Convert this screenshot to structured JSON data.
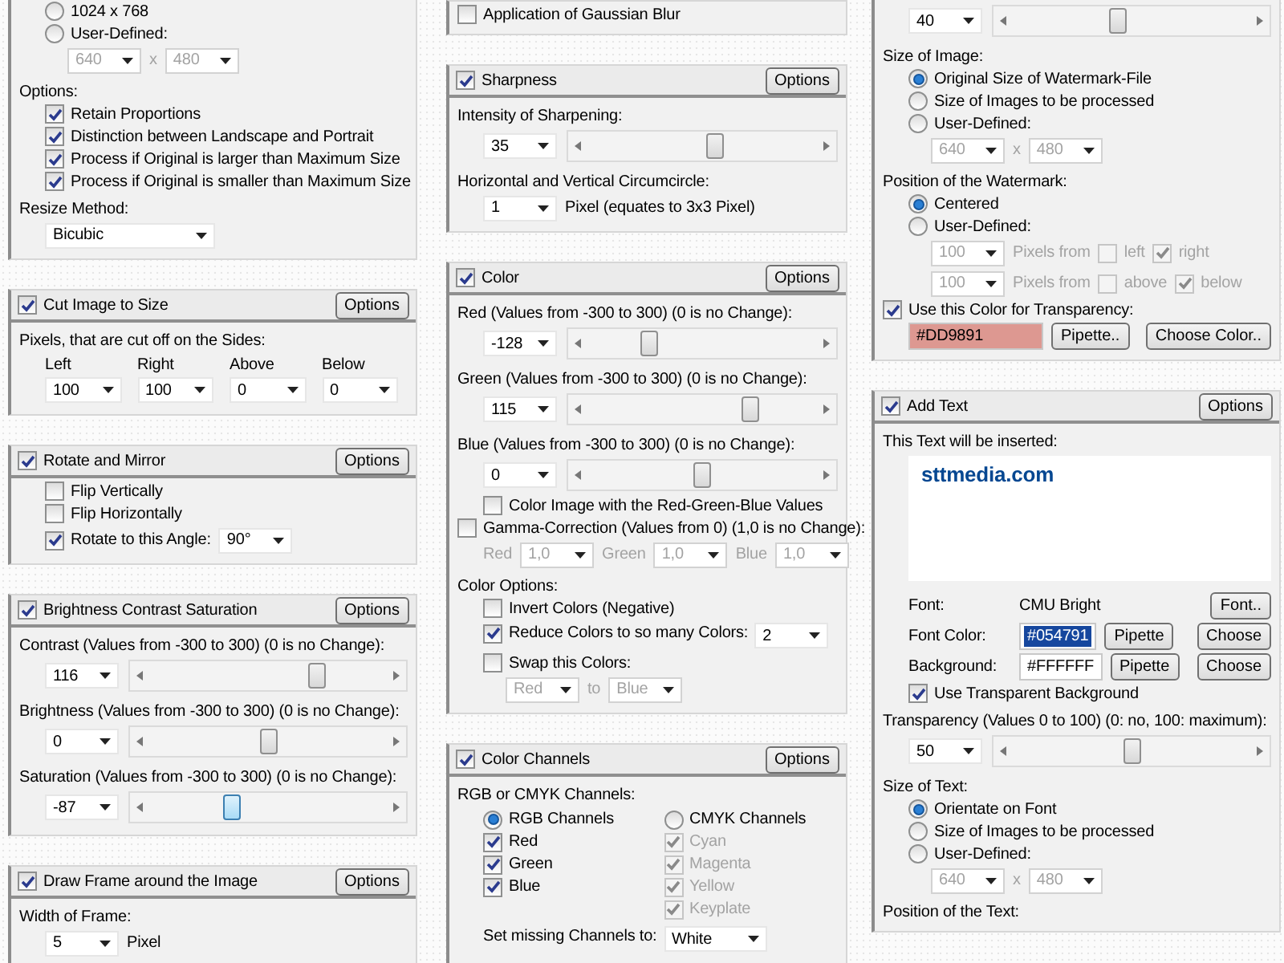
{
  "columns": [
    {
      "panels": [
        {
          "rows": [
            {
              "kind": "line",
              "items": [
                {
                  "kind": "radio",
                  "label": "1024 x 768",
                  "selected": false
                }
              ]
            },
            {
              "kind": "line",
              "items": [
                {
                  "kind": "radio",
                  "label": "User-Defined:",
                  "selected": false
                }
              ]
            },
            {
              "kind": "subline",
              "items": [
                {
                  "kind": "combo",
                  "value": "640",
                  "disabled": true
                },
                {
                  "kind": "text",
                  "text": "x",
                  "disabled": true
                },
                {
                  "kind": "combo",
                  "value": "480",
                  "disabled": true
                }
              ]
            },
            {
              "kind": "label",
              "text": "Options:"
            },
            {
              "kind": "line",
              "items": [
                {
                  "kind": "check",
                  "label": "Retain Proportions",
                  "checked": true,
                  "disabled": false
                }
              ]
            },
            {
              "kind": "line",
              "items": [
                {
                  "kind": "check",
                  "label": "Distinction between Landscape and Portrait",
                  "checked": true,
                  "disabled": false
                }
              ]
            },
            {
              "kind": "line",
              "items": [
                {
                  "kind": "check",
                  "label": "Process if Original is larger than Maximum Size",
                  "checked": true,
                  "disabled": false
                }
              ]
            },
            {
              "kind": "line",
              "items": [
                {
                  "kind": "check",
                  "label": "Process if Original is smaller than Maximum Size",
                  "checked": true,
                  "disabled": false
                }
              ]
            },
            {
              "kind": "label",
              "text": "Resize Method:"
            },
            {
              "kind": "line",
              "items": [
                {
                  "kind": "dropdown",
                  "value": "Bicubic",
                  "disabled": false
                }
              ]
            }
          ]
        },
        {
          "title": "Cut Image to Size",
          "checked": true,
          "button": "Options",
          "rows": [
            {
              "kind": "label",
              "text": "Pixels, that are cut off on the Sides:"
            },
            {
              "kind": "columns",
              "columns": [
                [
                  {
                    "kind": "text",
                    "text": "Left",
                    "disabled": false
                  },
                  {
                    "kind": "combo",
                    "value": "100",
                    "disabled": false
                  }
                ],
                [
                  {
                    "kind": "text",
                    "text": "Right",
                    "disabled": false
                  },
                  {
                    "kind": "combo",
                    "value": "100",
                    "disabled": false
                  }
                ],
                [
                  {
                    "kind": "text",
                    "text": "Above",
                    "disabled": false
                  },
                  {
                    "kind": "combo",
                    "value": "0",
                    "disabled": false
                  }
                ],
                [
                  {
                    "kind": "text",
                    "text": "Below",
                    "disabled": false
                  },
                  {
                    "kind": "combo",
                    "value": "0",
                    "disabled": false
                  }
                ]
              ]
            }
          ]
        },
        {
          "title": "Rotate and Mirror",
          "checked": true,
          "button": "Options",
          "rows": [
            {
              "kind": "line",
              "items": [
                {
                  "kind": "check",
                  "label": "Flip Vertically",
                  "checked": false,
                  "disabled": false
                }
              ]
            },
            {
              "kind": "line",
              "items": [
                {
                  "kind": "check",
                  "label": "Flip Horizontally",
                  "checked": false,
                  "disabled": false
                }
              ]
            },
            {
              "kind": "line",
              "items": [
                {
                  "kind": "check",
                  "label": "Rotate to this Angle:",
                  "checked": true,
                  "disabled": false
                },
                {
                  "kind": "combo",
                  "value": "90°",
                  "disabled": false
                }
              ]
            }
          ]
        },
        {
          "title": "Brightness Contrast Saturation",
          "checked": true,
          "button": "Options",
          "rows": [
            {
              "kind": "label",
              "text": "Contrast (Values from -300 to 300) (0 is no Change):"
            },
            {
              "kind": "slider",
              "value": "116",
              "level": 0.69,
              "focused": false
            },
            {
              "kind": "label",
              "text": "Brightness (Values from -300 to 300) (0 is no Change):"
            },
            {
              "kind": "slider",
              "value": "0",
              "level": 0.5,
              "focused": false
            },
            {
              "kind": "label",
              "text": "Saturation (Values from -300 to 300) (0 is no Change):"
            },
            {
              "kind": "slider",
              "value": "-87",
              "level": 0.36,
              "focused": true
            }
          ]
        },
        {
          "title": "Draw Frame around the Image",
          "checked": true,
          "button": "Options",
          "rows": [
            {
              "kind": "label",
              "text": "Width of Frame:"
            },
            {
              "kind": "line",
              "items": [
                {
                  "kind": "combo",
                  "value": "5",
                  "disabled": false
                },
                {
                  "kind": "text",
                  "text": "Pixel",
                  "disabled": false
                }
              ]
            }
          ]
        }
      ]
    },
    {
      "panels": [
        {
          "rows": [
            {
              "kind": "flush",
              "items": [
                {
                  "kind": "check",
                  "label": "Application of Gaussian Blur",
                  "checked": false,
                  "disabled": false
                }
              ]
            }
          ]
        },
        {
          "title": "Sharpness",
          "checked": true,
          "button": "Options",
          "rows": [
            {
              "kind": "label",
              "text": "Intensity of Sharpening:"
            },
            {
              "kind": "slider",
              "value": "35",
              "level": 0.55,
              "focused": false
            },
            {
              "kind": "label",
              "text": "Horizontal and Vertical Circumcircle:"
            },
            {
              "kind": "line",
              "items": [
                {
                  "kind": "combo",
                  "value": "1",
                  "disabled": false
                },
                {
                  "kind": "text",
                  "text": "Pixel (equates to 3x3 Pixel)",
                  "disabled": false
                }
              ]
            }
          ]
        },
        {
          "title": "Color",
          "checked": true,
          "button": "Options",
          "rows": [
            {
              "kind": "label",
              "text": "Red (Values from -300 to 300) (0 is no Change):"
            },
            {
              "kind": "slider",
              "value": "-128",
              "level": 0.29,
              "focused": false
            },
            {
              "kind": "label",
              "text": "Green (Values from -300 to 300) (0 is no Change):"
            },
            {
              "kind": "slider",
              "value": "115",
              "level": 0.69,
              "focused": false
            },
            {
              "kind": "label",
              "text": "Blue (Values from -300 to 300) (0 is no Change):"
            },
            {
              "kind": "slider",
              "value": "0",
              "level": 0.5,
              "focused": false
            },
            {
              "kind": "line",
              "items": [
                {
                  "kind": "check",
                  "label": "Color Image with the Red-Green-Blue Values",
                  "checked": false,
                  "disabled": false
                }
              ]
            },
            {
              "kind": "flush",
              "items": [
                {
                  "kind": "check",
                  "label": "Gamma-Correction (Values from 0) (1,0 is no Change):",
                  "checked": false,
                  "disabled": false
                }
              ]
            },
            {
              "kind": "line",
              "items": [
                {
                  "kind": "text",
                  "text": "Red",
                  "disabled": true
                },
                {
                  "kind": "combo",
                  "value": "1,0",
                  "disabled": true
                },
                {
                  "kind": "text",
                  "text": "Green",
                  "disabled": true
                },
                {
                  "kind": "combo",
                  "value": "1,0",
                  "disabled": true
                },
                {
                  "kind": "text",
                  "text": "Blue",
                  "disabled": true
                },
                {
                  "kind": "combo",
                  "value": "1,0",
                  "disabled": true
                }
              ]
            },
            {
              "kind": "label",
              "text": "Color Options:"
            },
            {
              "kind": "line",
              "items": [
                {
                  "kind": "check",
                  "label": "Invert Colors (Negative)",
                  "checked": false,
                  "disabled": false
                }
              ]
            },
            {
              "kind": "columns",
              "columns": [
                [
                  {
                    "kind": "check",
                    "label": "Reduce Colors to so many Colors:",
                    "checked": true,
                    "disabled": false
                  }
                ],
                [
                  {
                    "kind": "combo",
                    "value": "2",
                    "disabled": false
                  }
                ]
              ]
            },
            {
              "kind": "line",
              "items": [
                {
                  "kind": "check",
                  "label": "Swap this Colors:",
                  "checked": false,
                  "disabled": false
                }
              ]
            },
            {
              "kind": "subline",
              "items": [
                {
                  "kind": "combo",
                  "value": "Red",
                  "disabled": true
                },
                {
                  "kind": "text",
                  "text": "to",
                  "disabled": true
                },
                {
                  "kind": "combo",
                  "value": "Blue",
                  "disabled": true
                }
              ]
            }
          ]
        },
        {
          "title": "Color Channels",
          "checked": true,
          "button": "Options",
          "rows": [
            {
              "kind": "label",
              "text": "RGB or CMYK Channels:"
            },
            {
              "kind": "columns",
              "columns": [
                [
                  {
                    "kind": "radio",
                    "label": "RGB Channels",
                    "selected": true
                  },
                  {
                    "kind": "check",
                    "label": "Red",
                    "checked": true,
                    "disabled": false
                  },
                  {
                    "kind": "check",
                    "label": "Green",
                    "checked": true,
                    "disabled": false
                  },
                  {
                    "kind": "check",
                    "label": "Blue",
                    "checked": true,
                    "disabled": false
                  }
                ],
                [
                  {
                    "kind": "radio",
                    "label": "CMYK Channels",
                    "selected": false
                  },
                  {
                    "kind": "check",
                    "label": "Cyan",
                    "checked": true,
                    "disabled": true
                  },
                  {
                    "kind": "check",
                    "label": "Magenta",
                    "checked": true,
                    "disabled": true
                  },
                  {
                    "kind": "check",
                    "label": "Yellow",
                    "checked": true,
                    "disabled": true
                  },
                  {
                    "kind": "check",
                    "label": "Keyplate",
                    "checked": true,
                    "disabled": true
                  }
                ]
              ]
            },
            {
              "kind": "columns",
              "columns": [
                [
                  {
                    "kind": "text",
                    "text": "Set missing Channels to:",
                    "disabled": false
                  }
                ],
                [
                  {
                    "kind": "combo",
                    "value": "White",
                    "disabled": false
                  }
                ]
              ]
            }
          ]
        }
      ]
    },
    {
      "panels": [
        {
          "rows": [
            {
              "kind": "slider",
              "value": "40",
              "level": 0.45,
              "focused": false
            },
            {
              "kind": "label",
              "text": "Size of Image:"
            },
            {
              "kind": "line",
              "items": [
                {
                  "kind": "radio",
                  "label": "Original Size of Watermark-File",
                  "selected": true
                }
              ]
            },
            {
              "kind": "line",
              "items": [
                {
                  "kind": "radio",
                  "label": "Size of Images to be processed",
                  "selected": false
                }
              ]
            },
            {
              "kind": "line",
              "items": [
                {
                  "kind": "radio",
                  "label": "User-Defined:",
                  "selected": false
                }
              ]
            },
            {
              "kind": "subline",
              "items": [
                {
                  "kind": "combo",
                  "value": "640",
                  "disabled": true
                },
                {
                  "kind": "text",
                  "text": "x",
                  "disabled": true
                },
                {
                  "kind": "combo",
                  "value": "480",
                  "disabled": true
                }
              ]
            },
            {
              "kind": "label",
              "text": "Position of the Watermark:"
            },
            {
              "kind": "line",
              "items": [
                {
                  "kind": "radio",
                  "label": "Centered",
                  "selected": true
                }
              ]
            },
            {
              "kind": "line",
              "items": [
                {
                  "kind": "radio",
                  "label": "User-Defined:",
                  "selected": false
                }
              ]
            },
            {
              "kind": "subline",
              "items": [
                {
                  "kind": "combo",
                  "value": "100",
                  "disabled": true
                },
                {
                  "kind": "text",
                  "text": "Pixels from",
                  "disabled": true
                },
                {
                  "kind": "check",
                  "label": "left",
                  "checked": false,
                  "disabled": true
                },
                {
                  "kind": "check",
                  "label": "right",
                  "checked": true,
                  "disabled": true
                }
              ]
            },
            {
              "kind": "subline",
              "items": [
                {
                  "kind": "combo",
                  "value": "100",
                  "disabled": true
                },
                {
                  "kind": "text",
                  "text": "Pixels from",
                  "disabled": true
                },
                {
                  "kind": "check",
                  "label": "above",
                  "checked": false,
                  "disabled": true
                },
                {
                  "kind": "check",
                  "label": "below",
                  "checked": true,
                  "disabled": true
                }
              ]
            },
            {
              "kind": "flush",
              "items": [
                {
                  "kind": "check",
                  "label": "Use this Color for Transparency:",
                  "checked": true,
                  "disabled": false
                }
              ]
            },
            {
              "kind": "line",
              "items": [
                {
                  "kind": "field",
                  "value": "#DD9891",
                  "color": "#dd9891",
                  "selected": false
                },
                {
                  "kind": "button",
                  "label": "Pipette.."
                },
                {
                  "kind": "button",
                  "label": "Choose Color.."
                }
              ]
            }
          ]
        },
        {
          "title": "Add Text",
          "checked": true,
          "button": "Options",
          "rows": [
            {
              "kind": "label",
              "text": "This Text will be inserted:"
            },
            {
              "kind": "textarea",
              "text": "sttmedia.com"
            },
            {
              "kind": "line",
              "items": [
                {
                  "kind": "caption",
                  "text": "Font:"
                },
                {
                  "kind": "text",
                  "text": "CMU Bright",
                  "disabled": false
                },
                {
                  "kind": "button",
                  "label": "Font.."
                }
              ]
            },
            {
              "kind": "line",
              "items": [
                {
                  "kind": "caption",
                  "text": "Font Color:"
                },
                {
                  "kind": "field",
                  "value": "#054791",
                  "selected": true
                },
                {
                  "kind": "button",
                  "label": "Pipette"
                },
                {
                  "kind": "button",
                  "label": "Choose"
                }
              ]
            },
            {
              "kind": "line",
              "items": [
                {
                  "kind": "caption",
                  "text": "Background:"
                },
                {
                  "kind": "field",
                  "value": "#FFFFFF",
                  "selected": false
                },
                {
                  "kind": "button",
                  "label": "Pipette"
                },
                {
                  "kind": "button",
                  "label": "Choose"
                }
              ]
            },
            {
              "kind": "line",
              "items": [
                {
                  "kind": "check",
                  "label": "Use Transparent Background",
                  "checked": true,
                  "disabled": false
                }
              ]
            },
            {
              "kind": "label",
              "text": "Transparency (Values 0 to 100) (0: no, 100: maximum):"
            },
            {
              "kind": "slider",
              "value": "50",
              "level": 0.5,
              "focused": false
            },
            {
              "kind": "label",
              "text": "Size of Text:"
            },
            {
              "kind": "line",
              "items": [
                {
                  "kind": "radio",
                  "label": "Orientate on Font",
                  "selected": true
                }
              ]
            },
            {
              "kind": "line",
              "items": [
                {
                  "kind": "radio",
                  "label": "Size of Images to be processed",
                  "selected": false
                }
              ]
            },
            {
              "kind": "line",
              "items": [
                {
                  "kind": "radio",
                  "label": "User-Defined:",
                  "selected": false
                }
              ]
            },
            {
              "kind": "subline",
              "items": [
                {
                  "kind": "combo",
                  "value": "640",
                  "disabled": true
                },
                {
                  "kind": "text",
                  "text": "x",
                  "disabled": true
                },
                {
                  "kind": "combo",
                  "value": "480",
                  "disabled": true
                }
              ]
            },
            {
              "kind": "label",
              "text": "Position of the Text:"
            }
          ]
        }
      ]
    }
  ]
}
